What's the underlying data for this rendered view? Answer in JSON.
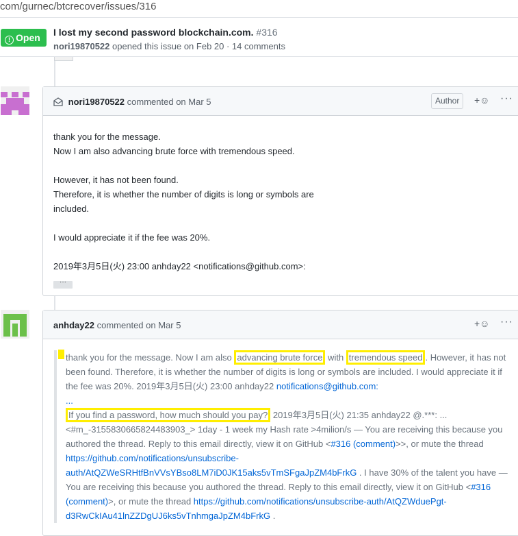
{
  "browser": {
    "url": "com/gurnec/btcrecover/issues/316"
  },
  "issue": {
    "state": "Open",
    "title": "I lost my second password blockchain.com.",
    "number": "#316",
    "author": "nori19870522",
    "meta": "opened this issue on Feb 20 · 14 comments"
  },
  "comments": [
    {
      "author": "nori19870522",
      "action": "commented on Mar 5",
      "badge": "Author",
      "react": "+☺",
      "more": "···",
      "lines": {
        "l1": "thank you for the message.",
        "l2": "Now I am also advancing brute force with tremendous speed.",
        "l3": "However, it has not been found.",
        "l4": "Therefore, it is whether the number of digits is long or symbols are",
        "l5": "included.",
        "l6": "I would appreciate it if the fee was 20%.",
        "l7": "2019年3月5日(火) 23:00 anhday22 <notifications@github.com>:"
      },
      "expand": "···"
    },
    {
      "author": "anhday22",
      "action": "commented on Mar 5",
      "react": "+☺",
      "more": "···",
      "quote": {
        "t1": "thank you for the message. Now I am also ",
        "h1": "advancing brute force",
        "t2": " with ",
        "h2": "tremendous speed",
        "t3": ". However, it has not been found. Therefore, it is whether the number of digits is long or symbols are included. I would appreciate it if the fee was 20%. 2019年3月5日(火) 23:00 anhday22 ",
        "link1": "notifications@github.com:",
        "dots": "...",
        "h3": "If you find a password, how much should you pay?",
        "t4": " 2019年3月5日(火) 21:35 anhday22 @.***: ... <#m_-3155830665824483903_> 1day - 1 week my Hash rate >4milion/s — You are receiving this because you authored the thread. Reply to this email directly, view it on GitHub <",
        "link2": "#316 (comment)",
        "t5": ">>, or mute the thread ",
        "link3": "https://github.com/notifications/unsubscribe-auth/AtQZWeSRHtfBnVVsYBso8LM7iD0JK15aks5vTmSFgaJpZM4bFrkG",
        "t6": " . I have 30% of the talent you have — You are receiving this because you authored the thread. Reply to this email directly, view it on GitHub <",
        "link4": "#316 (comment)",
        "t7": ">, or mute the thread ",
        "link5": "https://github.com/notifications/unsubscribe-auth/AtQZWduePgt-d3RwCkIAu41lnZZDgUJ6ks5vTnhmgaJpZM4bFrkG",
        "t8": " ."
      }
    }
  ]
}
